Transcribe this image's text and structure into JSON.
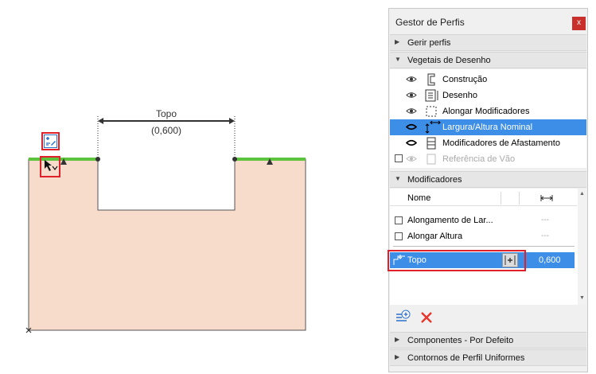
{
  "canvas": {
    "dimension_label": "Topo",
    "dimension_value": "(0,600)",
    "colors": {
      "fill": "#f8dccb",
      "outline": "#555555",
      "green_edge": "#5cc43c",
      "highlight": "#e0202a"
    },
    "icons": {
      "edit_icon": "profile-edit-icon",
      "cursor_icon": "cursor-icon"
    }
  },
  "panel": {
    "title": "Gestor de Perfis",
    "close_label": "x",
    "sections": {
      "manage": "Gerir perfis",
      "layers": "Vegetais de Desenho",
      "modifiers": "Modificadores",
      "components": "Componentes - Por Defeito",
      "contours": "Contornos de Perfil Uniformes"
    },
    "layers": [
      {
        "label": "Construção",
        "icon": "construction-icon",
        "visible": true,
        "selected": false
      },
      {
        "label": "Desenho",
        "icon": "drawing-icon",
        "visible": true,
        "selected": false
      },
      {
        "label": "Alongar Modificadores",
        "icon": "stretch-icon",
        "visible": true,
        "selected": false
      },
      {
        "label": "Largura/Altura Nominal",
        "icon": "nominal-size-icon",
        "visible": true,
        "selected": true
      },
      {
        "label": "Modificadores de Afastamento",
        "icon": "offset-icon",
        "visible": true,
        "selected": false
      },
      {
        "label": "Referência de Vão",
        "icon": "opening-ref-icon",
        "visible": false,
        "selected": false
      }
    ],
    "modifiers": {
      "header_name": "Nome",
      "rows": [
        {
          "label": "Alongamento de Lar...",
          "value": "---"
        },
        {
          "label": "Alongar Altura",
          "value": "---"
        }
      ],
      "offset_row": {
        "label": "Topo",
        "value": "0,600"
      }
    },
    "colors": {
      "selection": "#3d8ee6",
      "delete": "#e8352c"
    }
  }
}
